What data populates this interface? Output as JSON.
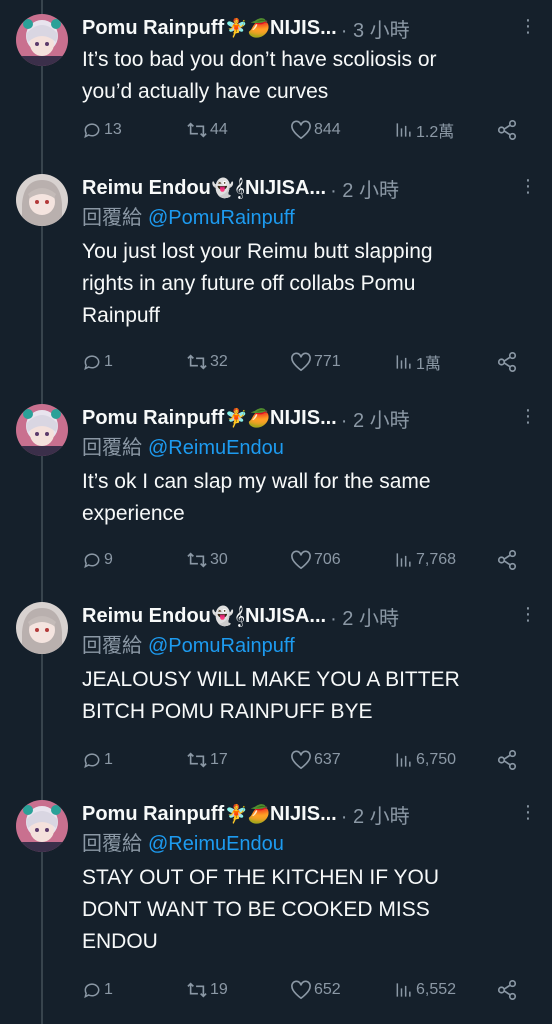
{
  "tweets": [
    {
      "author": "Pomu Rainpuff",
      "emoji": "🧚🥭",
      "suffix": "NIJIS...",
      "time": "· 3 小時",
      "reply_label": "",
      "reply_handle": "",
      "text": "It’s too bad you don’t have scoliosis or\nyou’d actually have curves",
      "replies": "13",
      "retweets": "44",
      "likes": "844",
      "views": "1.2萬"
    },
    {
      "author": "Reimu Endou",
      "emoji": "👻𝄞",
      "suffix": "NIJISA...",
      "time": "· 2 小時",
      "reply_label": "回覆給",
      "reply_handle": "@PomuRainpuff",
      "text": "You just lost your Reimu butt slapping\nrights in any future off collabs Pomu\nRainpuff",
      "replies": "1",
      "retweets": "32",
      "likes": "771",
      "views": "1萬"
    },
    {
      "author": "Pomu Rainpuff",
      "emoji": "🧚🥭",
      "suffix": "NIJIS...",
      "time": "· 2 小時",
      "reply_label": "回覆給",
      "reply_handle": "@ReimuEndou",
      "text": "It’s ok I can slap my wall for the same\nexperience",
      "replies": "9",
      "retweets": "30",
      "likes": "706",
      "views": "7,768"
    },
    {
      "author": "Reimu Endou",
      "emoji": "👻𝄞",
      "suffix": "NIJISA...",
      "time": "· 2 小時",
      "reply_label": "回覆給",
      "reply_handle": "@PomuRainpuff",
      "text": "JEALOUSY WILL MAKE YOU A BITTER\nBITCH POMU RAINPUFF BYE",
      "replies": "1",
      "retweets": "17",
      "likes": "637",
      "views": "6,750"
    },
    {
      "author": "Pomu Rainpuff",
      "emoji": "🧚🥭",
      "suffix": "NIJIS...",
      "time": "· 2 小時",
      "reply_label": "回覆給",
      "reply_handle": "@ReimuEndou",
      "text": "STAY OUT OF THE KITCHEN IF YOU\nDONT WANT TO BE COOKED MISS\nENDOU",
      "replies": "1",
      "retweets": "19",
      "likes": "652",
      "views": "6,552"
    }
  ],
  "colors": {
    "background": "#15202b",
    "text": "#f7f9f9",
    "muted": "#8b98a5",
    "link": "#1d9bf0",
    "thread_line": "#38444d"
  },
  "icons": [
    "reply-icon",
    "retweet-icon",
    "like-icon",
    "views-icon",
    "share-icon",
    "more-icon"
  ]
}
